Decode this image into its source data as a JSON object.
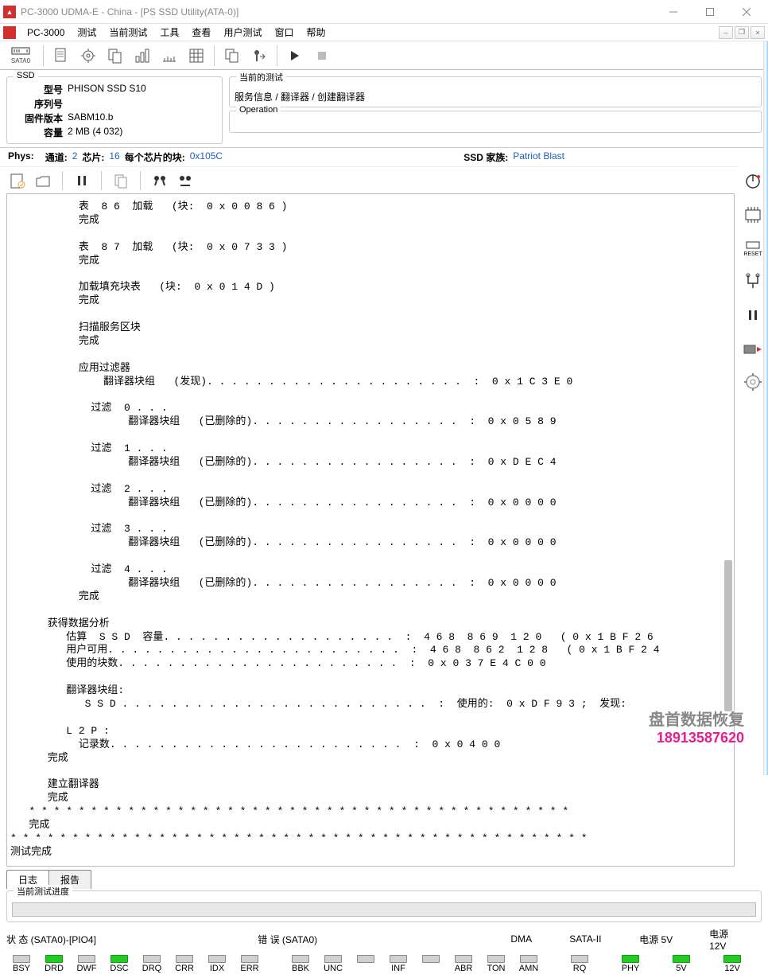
{
  "titlebar": {
    "title": "PC-3000 UDMA-E - China - [PS SSD Utility(ATA-0)]"
  },
  "menubar": {
    "brand": "PC-3000",
    "items": [
      "测试",
      "当前测试",
      "工具",
      "查看",
      "用户测试",
      "窗口",
      "帮助"
    ]
  },
  "ssd": {
    "legend": "SSD",
    "model_label": "型号",
    "model": "PHISON SSD S10",
    "serial_label": "序列号",
    "serial": "",
    "fw_label": "固件版本",
    "fw": "SABM10.b",
    "cap_label": "容量",
    "cap": "2 MB (4 032)"
  },
  "right_panel": {
    "group1_legend": "当前的测试",
    "group1_content": "服务信息 / 翻译器 / 创建翻译器",
    "group2_legend": "Operation",
    "group2_content": ""
  },
  "phys": {
    "phys_label": "Phys:",
    "ch_label": "通道:",
    "ch": "2",
    "chip_label": "芯片:",
    "chip": "16",
    "blocks_label": "每个芯片的块:",
    "blocks": "0x105C",
    "family_label": "SSD 家族:",
    "family": "Patriot Blast"
  },
  "tabs": {
    "log": "日志",
    "report": "报告"
  },
  "progress": {
    "legend": "当前测试进度"
  },
  "status_line": {
    "state": "状 态 (SATA0)-[PIO4]",
    "error": "错 误 (SATA0)",
    "dma": "DMA",
    "sata2": "SATA-II",
    "p5": "电源 5V",
    "p12": "电源 12V"
  },
  "leds": {
    "state": [
      {
        "lbl": "BSY",
        "on": false
      },
      {
        "lbl": "DRD",
        "on": true
      },
      {
        "lbl": "DWF",
        "on": false
      },
      {
        "lbl": "DSC",
        "on": true
      },
      {
        "lbl": "DRQ",
        "on": false
      },
      {
        "lbl": "CRR",
        "on": false
      },
      {
        "lbl": "IDX",
        "on": false
      },
      {
        "lbl": "ERR",
        "on": false
      }
    ],
    "error": [
      {
        "lbl": "BBK",
        "on": false
      },
      {
        "lbl": "UNC",
        "on": false
      },
      {
        "lbl": "",
        "on": false
      },
      {
        "lbl": "INF",
        "on": false
      },
      {
        "lbl": "",
        "on": false
      },
      {
        "lbl": "ABR",
        "on": false
      },
      {
        "lbl": "TON",
        "on": false
      },
      {
        "lbl": "AMN",
        "on": false
      }
    ],
    "dma": [
      {
        "lbl": "RQ",
        "on": false
      }
    ],
    "sata2": [
      {
        "lbl": "PHY",
        "on": true
      }
    ],
    "p5": [
      {
        "lbl": "5V",
        "on": true
      }
    ],
    "p12": [
      {
        "lbl": "12V",
        "on": true
      }
    ]
  },
  "log_text": "           表  8 6  加载   (块:  0 x 0 0 8 6 )\n           完成\n\n           表  8 7  加载   (块:  0 x 0 7 3 3 )\n           完成\n\n           加载填充块表   (块:  0 x 0 1 4 D )\n           完成\n\n           扫描服务区块\n           完成\n\n           应用过滤器\n               翻译器块组   (发现). . . . . . . . . . . . . . . . . . . . .  :  0 x 1 C 3 E 0\n\n             过滤  0 . . .\n                   翻译器块组   (已删除的). . . . . . . . . . . . . . . . .  :  0 x 0 5 8 9\n\n             过滤  1 . . .\n                   翻译器块组   (已删除的). . . . . . . . . . . . . . . . .  :  0 x D E C 4\n\n             过滤  2 . . .\n                   翻译器块组   (已删除的). . . . . . . . . . . . . . . . .  :  0 x 0 0 0 0\n\n             过滤  3 . . .\n                   翻译器块组   (已删除的). . . . . . . . . . . . . . . . .  :  0 x 0 0 0 0\n\n             过滤  4 . . .\n                   翻译器块组   (已删除的). . . . . . . . . . . . . . . . .  :  0 x 0 0 0 0\n           完成\n\n      获得数据分析\n         估算  S S D  容量. . . . . . . . . . . . . . . . . . .  :  4 6 8  8 6 9  1 2 0   ( 0 x 1 B F 2 6\n         用户可用. . . . . . . . . . . . . . . . . . . . . . . .  :  4 6 8  8 6 2  1 2 8   ( 0 x 1 B F 2 4\n         使用的块数. . . . . . . . . . . . . . . . . . . . . . .  :  0 x 0 3 7 E 4 C 0 0\n\n         翻译器块组:\n            S S D . . . . . . . . . . . . . . . . . . . . . . . . .  :  使用的:  0 x D F 9 3 ;  发现:\n\n         L 2 P :\n           记录数. . . . . . . . . . . . . . . . . . . . . . . .  :  0 x 0 4 0 0\n      完成\n\n      建立翻译器\n      完成\n   * * * * * * * * * * * * * * * * * * * * * * * * * * * * * * * * * * * * * * * * * * * *\n   完成\n* * * * * * * * * * * * * * * * * * * * * * * * * * * * * * * * * * * * * * * * * * * * * * *\n测试完成",
  "watermark": {
    "t1": "盘首数据恢复",
    "t2": "18913587620"
  }
}
